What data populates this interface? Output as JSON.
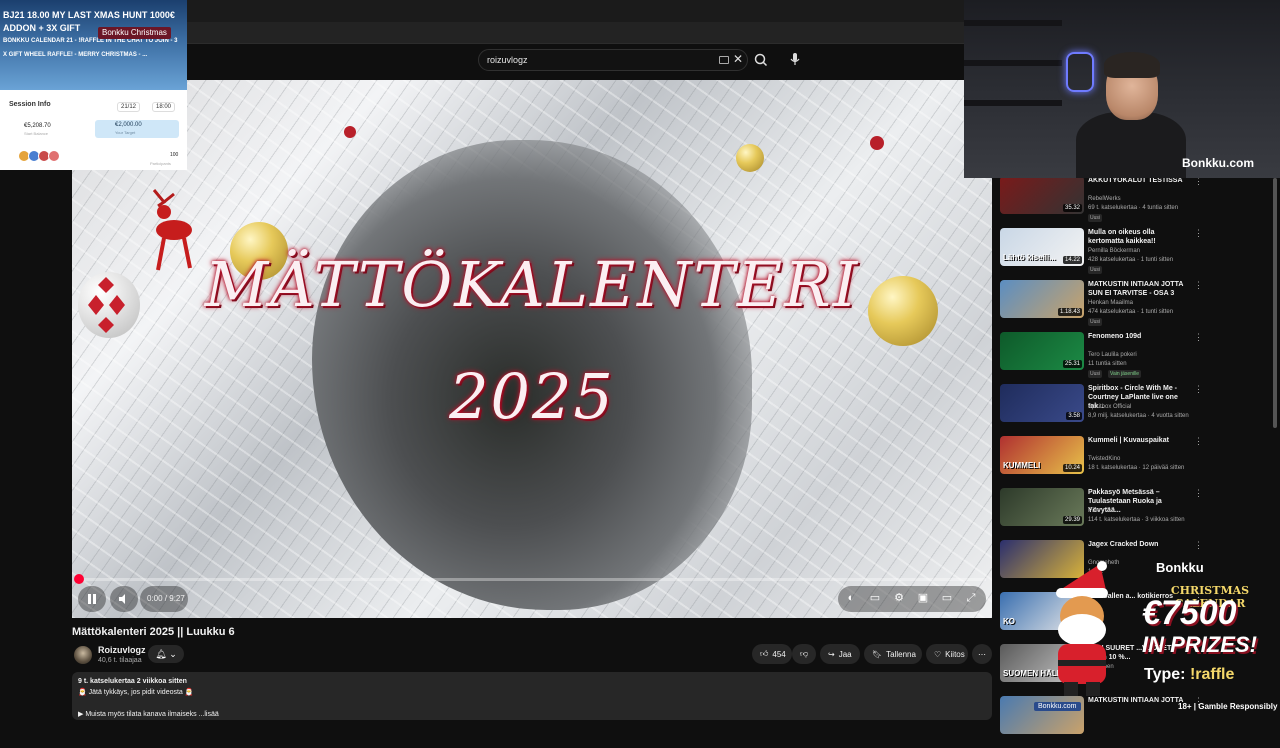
{
  "search": {
    "query": "roizuvlogz"
  },
  "video": {
    "overlay_title_line1": "MÄTTÖKALENTERI",
    "overlay_title_line2": "2025",
    "progress_fraction": 0.0,
    "time_display": "0:00 / 9:27",
    "title": "Mättökalenteri 2025 || Luukku 6"
  },
  "channel": {
    "name": "Roizuvlogz",
    "subscribers": "40,6 t. tilaajaa"
  },
  "actions": {
    "likes": "454",
    "share": "Jaa",
    "save": "Tallenna",
    "thanks": "Kiitos"
  },
  "description": {
    "line1": "9 t. katselukertaa  2 viikkoa sitten",
    "line2": "🎅 Jätä tykkäys, jos pidit videosta 🎅",
    "line3": "▶ Muista myös tilata kanava ilmaiseks  ...lisää"
  },
  "recommendations": [
    {
      "title": "AKKUTYÖKALUT TESTISSA",
      "channel": "RebelWerks",
      "meta": "69 t. katselukertaa · 4 tuntia sitten",
      "badge": "Uusi",
      "duration": "35.32",
      "colors": [
        "#7a1a1a",
        "#333"
      ]
    },
    {
      "title": "Mulla on oikeus olla kertomatta kaikkea!!",
      "channel": "Pernilla Böckerman",
      "meta": "428 katselukertaa · 1 tunti sitten",
      "badge": "Uusi",
      "duration": "14.22",
      "thumb_text": "Lähtö kiseili...",
      "colors": [
        "#c9d7e6",
        "#f3f3f3"
      ]
    },
    {
      "title": "MATKUSTIN INTIAAN JOTTA SUN EI TARVITSE - OSA 3",
      "channel": "Henkan Maailma",
      "meta": "474 katselukertaa · 1 tunti sitten",
      "badge": "Uusi",
      "duration": "1.18.43",
      "colors": [
        "#5b8ec2",
        "#c9a36a"
      ]
    },
    {
      "title": "Fenomeno 109d",
      "channel": "Tero Laulila pokeri",
      "meta": "11 tuntia sitten",
      "badge": "Uusi",
      "badge2": "Vain jäsenille",
      "duration": "25.31",
      "colors": [
        "#0e5a2a",
        "#1c8a45"
      ]
    },
    {
      "title": "Spiritbox - Circle With Me - Courtney LaPlante live one tak...",
      "channel": "Spiritbox Official",
      "meta": "8,9 milj. katselukertaa · 4 vuotta sitten",
      "duration": "3.58",
      "colors": [
        "#1f2c5c",
        "#3a4a8a"
      ]
    },
    {
      "title": "Kummeli | Kuvauspaikat",
      "channel": "TwistedKino",
      "meta": "18 t. katselukertaa · 12 päivää sitten",
      "duration": "10.24",
      "thumb_text": "KUMMELI",
      "colors": [
        "#b03030",
        "#e8c24a"
      ]
    },
    {
      "title": "Pakkasyö Metsässä – Tuulastetaan Ruoka ja Yövytää...",
      "channel": "Pate",
      "meta": "114 t. katselukertaa · 3 viikkoa sitten",
      "duration": "29.39",
      "colors": [
        "#2d3a2a",
        "#6a7a5a"
      ]
    },
    {
      "title": "Jagex Cracked Down",
      "channel": "Gnomeheth",
      "meta": "1,3 ...",
      "duration": "",
      "colors": [
        "#2b2f6e",
        "#d8b23a"
      ]
    },
    {
      "title": "VilleGallen a... kotikierros",
      "channel": "",
      "meta": "",
      "duration": "",
      "thumb_text": "KO",
      "colors": [
        "#3a6fb0",
        "#e8e8e8"
      ]
    },
    {
      "title": "...EN SUURET ...VUODET - miten 10 %...",
      "channel": "Mikkonen",
      "meta": "",
      "badge": "Uusi",
      "duration": "23.24",
      "thumb_text": "SUOMEN HÄLKÄVU...",
      "colors": [
        "#5a5a5a",
        "#c8c8c8"
      ]
    },
    {
      "title": "MATKUSTIN INTIAAN JOTTA",
      "channel": "",
      "meta": "",
      "duration": "",
      "colors": [
        "#4a7ab0",
        "#caa26a"
      ]
    }
  ],
  "stream_overlay": {
    "banner_line1": "BJ21 18.00 MY LAST XMAS HUNT 1000€",
    "banner_line2": "ADDON + 3X GIFT",
    "banner_line3": "BONKKU CALENDAR 21 - !RAFFLE IN THE CHAT TO JOIN - 3",
    "banner_line4": "X GIFT WHEEL RAFFLE! - MERRY CHRISTMAS - ...",
    "banner_tag": "Bonkku Christmas",
    "session_title": "Session Info",
    "session_date": "21/12",
    "session_time": "18:00",
    "start_balance": "€5,208.70",
    "start_balance_label": "Start Balance",
    "target": "€2,000.00",
    "target_label": "Your Target",
    "participants": "100",
    "participants_label": "Participants",
    "webcam_brand": "Bonkku.com",
    "promo_brand": "Bonkku",
    "promo_sub": "CHRISTMAS CALENDAR",
    "promo_amount": "€7500",
    "promo_prizes": "IN PRIZES!",
    "promo_type_prefix": "Type:",
    "promo_type_cmd": "!raffle",
    "footer": "18+ | Gamble Responsibly",
    "bottom_badge": "Bonkku.com"
  },
  "icons": [
    "search-icon",
    "mic-icon",
    "keyboard-icon",
    "close-icon",
    "pause-icon",
    "volume-icon",
    "bell-icon",
    "like-icon",
    "dislike-icon",
    "share-icon",
    "save-icon",
    "thanks-icon",
    "more-icon"
  ],
  "colors": {
    "accent": "#ff0033",
    "background": "#0f0f0f",
    "surface": "#272727"
  }
}
